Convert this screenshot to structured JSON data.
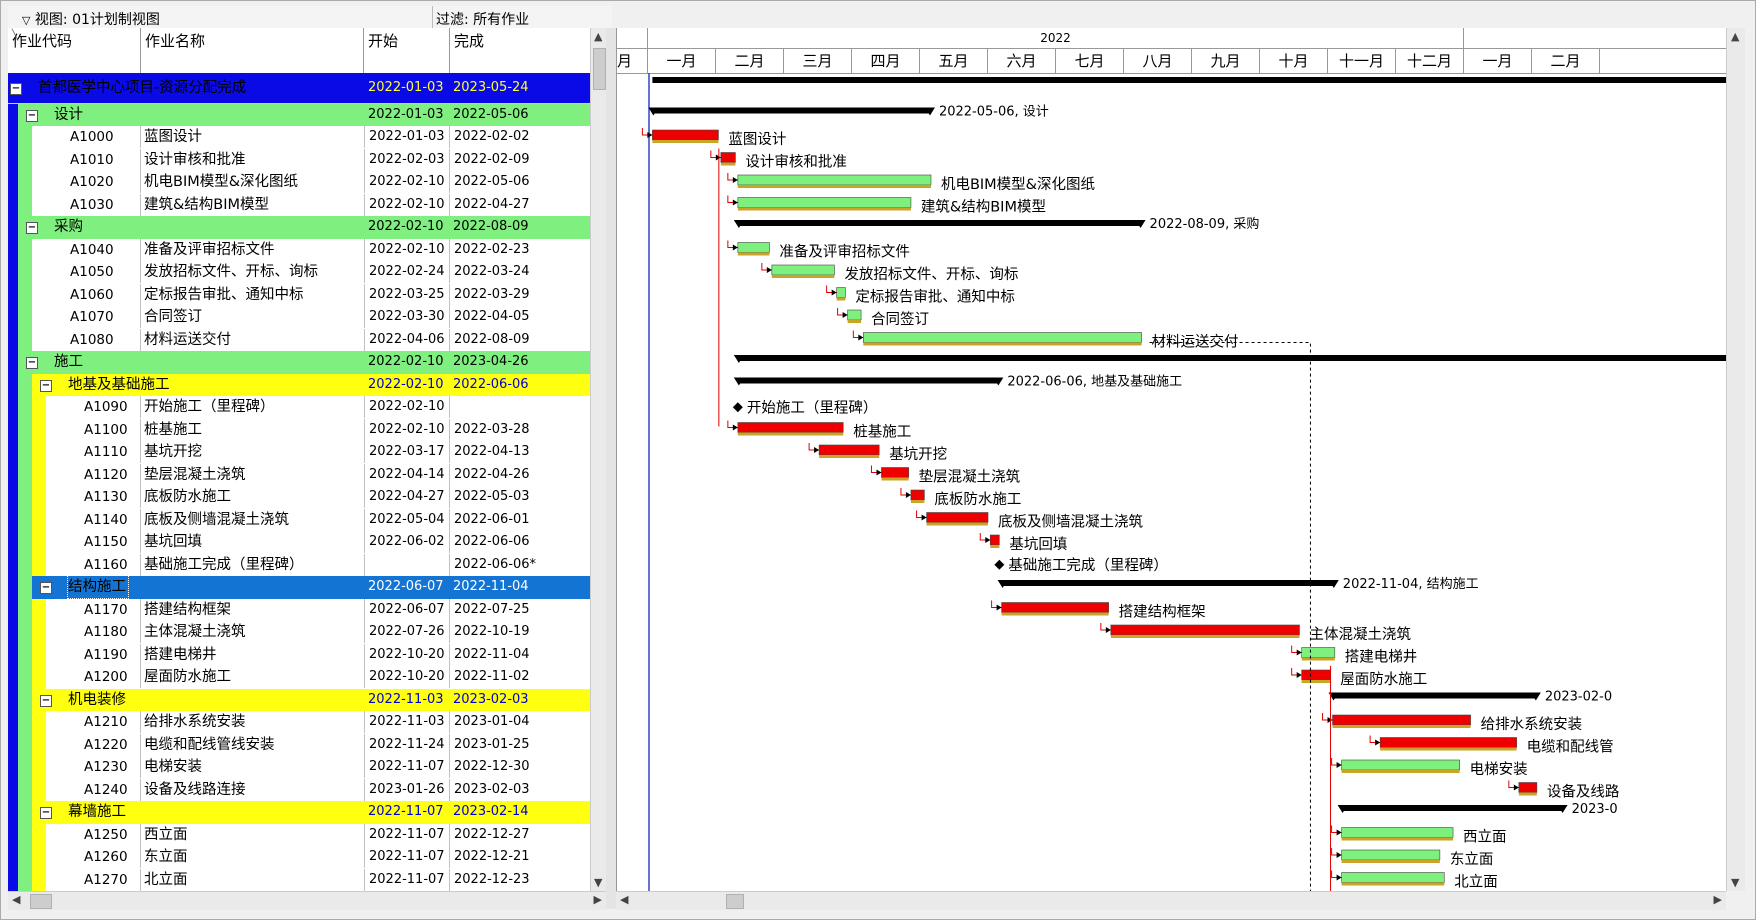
{
  "viewbar": {
    "view": "视图: 01计划制视图",
    "filter": "过滤:  所有作业"
  },
  "columns": {
    "code": "作业代码",
    "name": "作业名称",
    "start": "开始",
    "finish": "完成"
  },
  "rows": [
    {
      "type": "l0",
      "code": "",
      "name": "首都医学中心项目-资源分配完成",
      "start": "2022-01-03",
      "finish": "2023-05-24"
    },
    {
      "type": "l1",
      "code": "",
      "name": "设计",
      "start": "2022-01-03",
      "finish": "2022-05-06"
    },
    {
      "type": "act",
      "code": "A1000",
      "name": "蓝图设计",
      "start": "2022-01-03",
      "finish": "2022-02-02"
    },
    {
      "type": "act",
      "code": "A1010",
      "name": "设计审核和批准",
      "start": "2022-02-03",
      "finish": "2022-02-09"
    },
    {
      "type": "act",
      "code": "A1020",
      "name": "机电BIM模型&深化图纸",
      "start": "2022-02-10",
      "finish": "2022-05-06"
    },
    {
      "type": "act",
      "code": "A1030",
      "name": "建筑&结构BIM模型",
      "start": "2022-02-10",
      "finish": "2022-04-27"
    },
    {
      "type": "l1",
      "code": "",
      "name": "采购",
      "start": "2022-02-10",
      "finish": "2022-08-09"
    },
    {
      "type": "act",
      "code": "A1040",
      "name": "准备及评审招标文件",
      "start": "2022-02-10",
      "finish": "2022-02-23"
    },
    {
      "type": "act",
      "code": "A1050",
      "name": "发放招标文件、开标、询标",
      "start": "2022-02-24",
      "finish": "2022-03-24"
    },
    {
      "type": "act",
      "code": "A1060",
      "name": "定标报告审批、通知中标",
      "start": "2022-03-25",
      "finish": "2022-03-29"
    },
    {
      "type": "act",
      "code": "A1070",
      "name": "合同签订",
      "start": "2022-03-30",
      "finish": "2022-04-05"
    },
    {
      "type": "act",
      "code": "A1080",
      "name": "材料运送交付",
      "start": "2022-04-06",
      "finish": "2022-08-09"
    },
    {
      "type": "l1",
      "code": "",
      "name": "施工",
      "start": "2022-02-10",
      "finish": "2023-04-26"
    },
    {
      "type": "l2",
      "code": "",
      "name": "地基及基础施工",
      "start": "2022-02-10",
      "finish": "2022-06-06"
    },
    {
      "type": "act2",
      "code": "A1090",
      "name": "开始施工（里程碑）",
      "start": "2022-02-10",
      "finish": ""
    },
    {
      "type": "act2",
      "code": "A1100",
      "name": "桩基施工",
      "start": "2022-02-10",
      "finish": "2022-03-28"
    },
    {
      "type": "act2",
      "code": "A1110",
      "name": "基坑开挖",
      "start": "2022-03-17",
      "finish": "2022-04-13"
    },
    {
      "type": "act2",
      "code": "A1120",
      "name": "垫层混凝土浇筑",
      "start": "2022-04-14",
      "finish": "2022-04-26"
    },
    {
      "type": "act2",
      "code": "A1130",
      "name": "底板防水施工",
      "start": "2022-04-27",
      "finish": "2022-05-03"
    },
    {
      "type": "act2",
      "code": "A1140",
      "name": "底板及侧墙混凝土浇筑",
      "start": "2022-05-04",
      "finish": "2022-06-01"
    },
    {
      "type": "act2",
      "code": "A1150",
      "name": "基坑回填",
      "start": "2022-06-02",
      "finish": "2022-06-06"
    },
    {
      "type": "act2",
      "code": "A1160",
      "name": "基础施工完成（里程碑）",
      "start": "",
      "finish": "2022-06-06*"
    },
    {
      "type": "sel",
      "code": "",
      "name": "结构施工",
      "start": "2022-06-07",
      "finish": "2022-11-04"
    },
    {
      "type": "act2",
      "code": "A1170",
      "name": "搭建结构框架",
      "start": "2022-06-07",
      "finish": "2022-07-25"
    },
    {
      "type": "act2",
      "code": "A1180",
      "name": "主体混凝土浇筑",
      "start": "2022-07-26",
      "finish": "2022-10-19"
    },
    {
      "type": "act2",
      "code": "A1190",
      "name": "搭建电梯井",
      "start": "2022-10-20",
      "finish": "2022-11-04"
    },
    {
      "type": "act2",
      "code": "A1200",
      "name": "屋面防水施工",
      "start": "2022-10-20",
      "finish": "2022-11-02"
    },
    {
      "type": "l2",
      "code": "",
      "name": "机电装修",
      "start": "2022-11-03",
      "finish": "2023-02-03"
    },
    {
      "type": "act2",
      "code": "A1210",
      "name": "给排水系统安装",
      "start": "2022-11-03",
      "finish": "2023-01-04"
    },
    {
      "type": "act2",
      "code": "A1220",
      "name": "电缆和配线管线安装",
      "start": "2022-11-24",
      "finish": "2023-01-25"
    },
    {
      "type": "act2",
      "code": "A1230",
      "name": "电梯安装",
      "start": "2022-11-07",
      "finish": "2022-12-30"
    },
    {
      "type": "act2",
      "code": "A1240",
      "name": "设备及线路连接",
      "start": "2023-01-26",
      "finish": "2023-02-03"
    },
    {
      "type": "l2",
      "code": "",
      "name": "幕墙施工",
      "start": "2022-11-07",
      "finish": "2023-02-14"
    },
    {
      "type": "act2",
      "code": "A1250",
      "name": "西立面",
      "start": "2022-11-07",
      "finish": "2022-12-27"
    },
    {
      "type": "act2",
      "code": "A1260",
      "name": "东立面",
      "start": "2022-11-07",
      "finish": "2022-12-21"
    },
    {
      "type": "act2",
      "code": "A1270",
      "name": "北立面",
      "start": "2022-11-07",
      "finish": "2022-12-23"
    }
  ],
  "timeline": {
    "year": "2022",
    "months": [
      "月",
      "一月",
      "二月",
      "三月",
      "四月",
      "五月",
      "六月",
      "七月",
      "八月",
      "九月",
      "十月",
      "十一月",
      "十二月",
      "一月",
      "二月"
    ]
  },
  "gantt_labels": {
    "design_summary": "2022-05-06, 设计",
    "proc_summary": "2022-08-09, 采购",
    "found_summary": "2022-06-06, 地基及基础施工",
    "struct_summary": "2022-11-04, 结构施工",
    "mep_summary": "2023-02-0",
    "curtain_summary": "2023-0",
    "a1220_label": "电缆和配线管",
    "a1240_label": "设备及线路",
    "a1270_label": "北立面"
  },
  "colors": {
    "critical": "#ee0000",
    "normal": "#7ef07e",
    "wbs0": "#0a0ae6",
    "wbs1": "#7ff07f",
    "wbs2": "#ffff10",
    "selected": "#1474d4"
  }
}
